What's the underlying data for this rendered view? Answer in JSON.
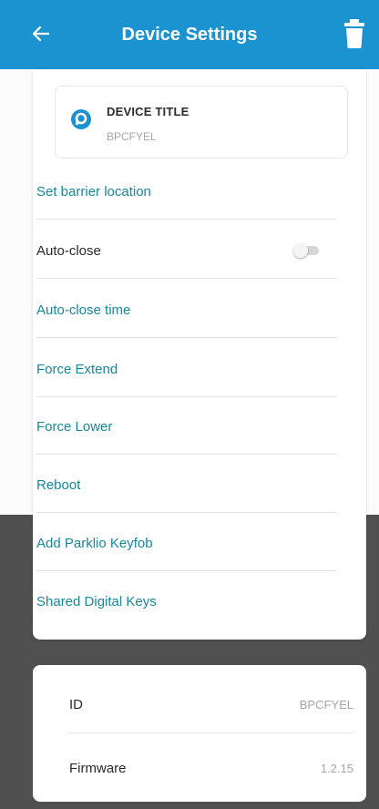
{
  "header": {
    "title": "Device Settings",
    "back_icon": "arrow-left-icon",
    "delete_icon": "trash-icon",
    "color": "#1c93d1"
  },
  "device": {
    "label": "DEVICE TITLE",
    "value": "BPCFYEL",
    "logo_icon": "parklio-logo-icon"
  },
  "settings": {
    "set_barrier_location": "Set barrier location",
    "auto_close": "Auto-close",
    "auto_close_enabled": false,
    "auto_close_time": "Auto-close time",
    "force_extend": "Force Extend",
    "force_lower": "Force Lower",
    "reboot": "Reboot",
    "add_keyfob": "Add Parklio Keyfob",
    "shared_keys": "Shared Digital Keys",
    "link_color": "#17879a"
  },
  "info": {
    "id_label": "ID",
    "id_value": "BPCFYEL",
    "firmware_label": "Firmware",
    "firmware_value": "1.2.15"
  }
}
